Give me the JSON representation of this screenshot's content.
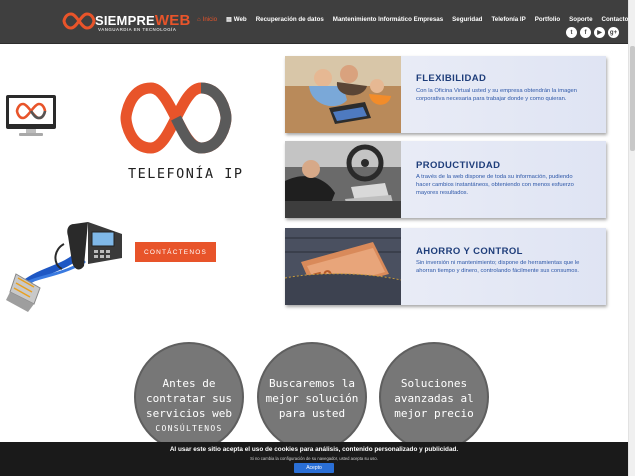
{
  "header": {
    "logo_main": "SIEMPRE",
    "logo_accent": "WEB",
    "logo_tagline": "VANGUARDIA EN TECNOLOGÍA",
    "nav": [
      {
        "label": "Inicio",
        "icon": "home-icon",
        "active": true
      },
      {
        "label": "Web",
        "icon": "document-icon",
        "active": false
      },
      {
        "label": "Recuperación de datos",
        "active": false
      },
      {
        "label": "Mantenimiento Informático Empresas",
        "active": false
      },
      {
        "label": "Seguridad",
        "active": false
      },
      {
        "label": "Telefonía IP",
        "active": false
      },
      {
        "label": "Portfolio",
        "active": false
      },
      {
        "label": "Soporte",
        "active": false
      },
      {
        "label": "Contacto",
        "active": false
      }
    ],
    "social": [
      {
        "icon": "twitter-icon",
        "glyph": "t"
      },
      {
        "icon": "facebook-icon",
        "glyph": "f"
      },
      {
        "icon": "youtube-icon",
        "glyph": "▶"
      },
      {
        "icon": "googleplus-icon",
        "glyph": "g+"
      }
    ]
  },
  "hero": {
    "title": "TELEFONÍA IP",
    "contact_label": "CONTÁCTENOS"
  },
  "features": [
    {
      "title": "FLEXIBILIDAD",
      "text": "Con la Oficina Virtual usted y su empresa obtendrán la imagen corporativa necesaria para trabajar donde y como quieran."
    },
    {
      "title": "PRODUCTIVIDAD",
      "text": "A través de la web dispone de toda su información, pudiendo hacer cambios instantáneos, obteniendo con menos esfuerzo mayores resultados."
    },
    {
      "title": "AHORRO Y CONTROL",
      "text": "Sin inversión ni mantenimiento; dispone de herramientas que le ahorran tiempo y dinero, controlando fácilmente sus consumos."
    }
  ],
  "circles": [
    {
      "text": "Antes de contratar sus servicios web",
      "sub": "CONSÚLTENOS"
    },
    {
      "text": "Buscaremos la mejor solución para usted"
    },
    {
      "text": "Soluciones avanzadas al mejor precio"
    }
  ],
  "cookie": {
    "main": "Al usar este sitio acepta el uso de cookies para análisis, contenido personalizado y publicidad.",
    "sub": "Si no cambia la configuración de su navegador, usted acepta su uso.",
    "accept": "Acepto"
  },
  "colors": {
    "accent": "#e8542a",
    "header_bg": "#3f3f3f",
    "card_title": "#1e3d7a",
    "card_text": "#2d57a8",
    "circle": "#777777"
  }
}
